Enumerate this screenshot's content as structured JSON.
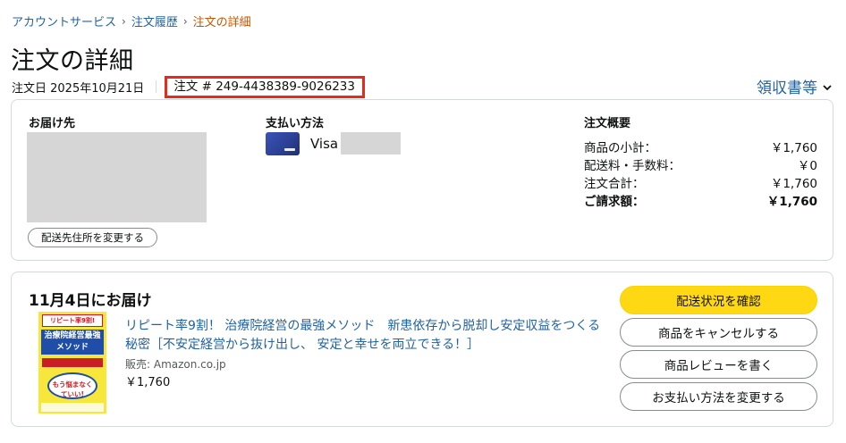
{
  "breadcrumb": {
    "account": "アカウントサービス",
    "history": "注文履歴",
    "current": "注文の詳細",
    "separator": "›"
  },
  "page_title": "注文の詳細",
  "order": {
    "date_label": "注文日 2025年10月21日",
    "number_label": "注文 # 249-4438389-9026233"
  },
  "invoice_link": "領収書等",
  "shipping": {
    "heading": "お届け先",
    "change_button": "配送先住所を変更する"
  },
  "payment": {
    "heading": "支払い方法",
    "card_brand": "Visa"
  },
  "summary": {
    "heading": "注文概要",
    "rows": [
      {
        "label": "商品の小計：",
        "value": "￥1,760"
      },
      {
        "label": "配送料・手数料：",
        "value": "￥0"
      },
      {
        "label": "注文合計：",
        "value": "￥1,760"
      },
      {
        "label": "ご請求額：",
        "value": "￥1,760"
      }
    ]
  },
  "shipment": {
    "delivery_title": "11月4日にお届け",
    "product_title": "リピート率9割！ 治療院経営の最強メソッド　新患依存から脱却し安定収益をつくる秘密［不安定経営から抜け出し、 安定と幸せを両立できる！］",
    "seller": "販売: Amazon.co.jp",
    "price": "￥1,760",
    "cover": {
      "top": "リピート率9割!",
      "main": "治療院経営最強メソッド",
      "bubble": "もう悩まなくていい!"
    }
  },
  "actions": {
    "track": "配送状況を確認",
    "cancel": "商品をキャンセルする",
    "review": "商品レビューを書く",
    "change_payment": "お支払い方法を変更する"
  },
  "colors": {
    "link": "#2162a1",
    "current_crumb": "#c45500",
    "primary_button": "#ffd814",
    "highlight_box": "#e8291c"
  }
}
